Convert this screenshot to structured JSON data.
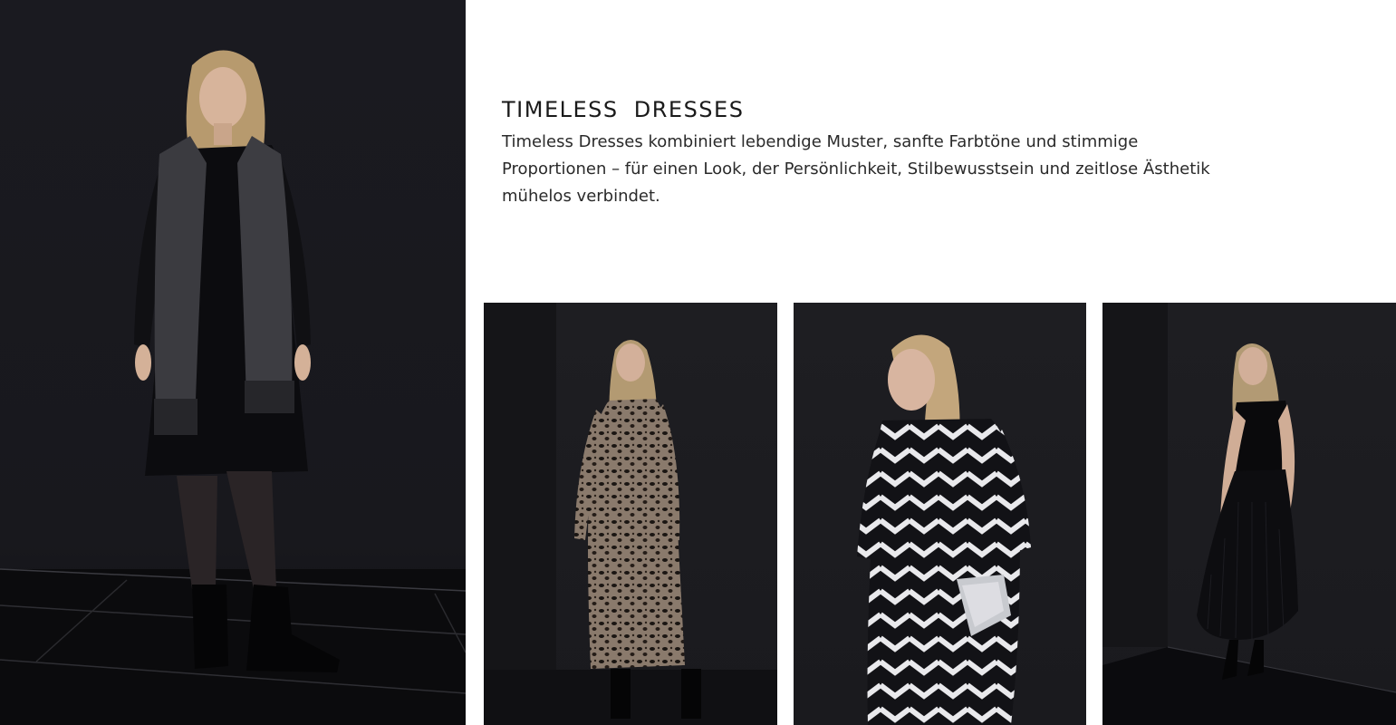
{
  "section": {
    "title": "TIMELESS DRESSES",
    "description": "Timeless Dresses kombiniert lebendige Muster, sanfte Farbtöne und stimmige Proportionen – für einen Look, der Persönlichkeit, Stilbewusstsein und zeitlose Ästhetik mühelos verbindet."
  },
  "images": {
    "hero": "model-black-dress-scarf-photo",
    "tiles": [
      "model-leopard-print-dress-photo",
      "model-zigzag-pattern-dress-photo",
      "model-black-pleated-dress-photo"
    ]
  },
  "colors": {
    "background": "#ffffff",
    "photo_backdrop": "#1a1a1f",
    "text": "#1b1b1b"
  }
}
